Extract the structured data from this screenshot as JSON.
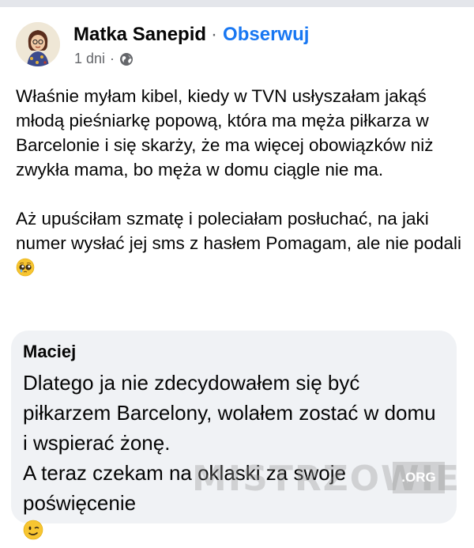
{
  "post": {
    "author": "Matka Sanepid",
    "separator": "·",
    "follow_label": "Obserwuj",
    "time": "1 dni",
    "time_separator": "·",
    "privacy_icon": "globe-icon",
    "paragraph1": "Właśnie myłam kibel, kiedy w TVN usłyszałam jakąś młodą pieśniarkę popową, która ma męża piłkarza w Barcelonie i się skarży, że ma więcej obowiązków niż zwykła mama, bo męża w domu ciągle nie ma.",
    "paragraph2": "Aż upuściłam szmatę i poleciałam posłuchać, na jaki numer wysłać jej sms z hasłem Pomagam, ale nie podali",
    "paragraph2_emoji": "pleading-face-emoji"
  },
  "comment": {
    "author": "Maciej",
    "line1": "Dlatego ja nie zdecydowałem się być piłkarzem Barcelony, wolałem zostać w domu i wspierać żonę.",
    "line2": "A teraz czekam na oklaski za swoje poświęcenie",
    "line2_emoji": "winking-face-emoji"
  },
  "watermark": {
    "text": "MISTRZOWIE",
    "suffix": ".ORG"
  },
  "colors": {
    "link": "#1877f2",
    "secondary_text": "#65676b",
    "comment_bg": "#f0f2f5",
    "text": "#050505"
  }
}
